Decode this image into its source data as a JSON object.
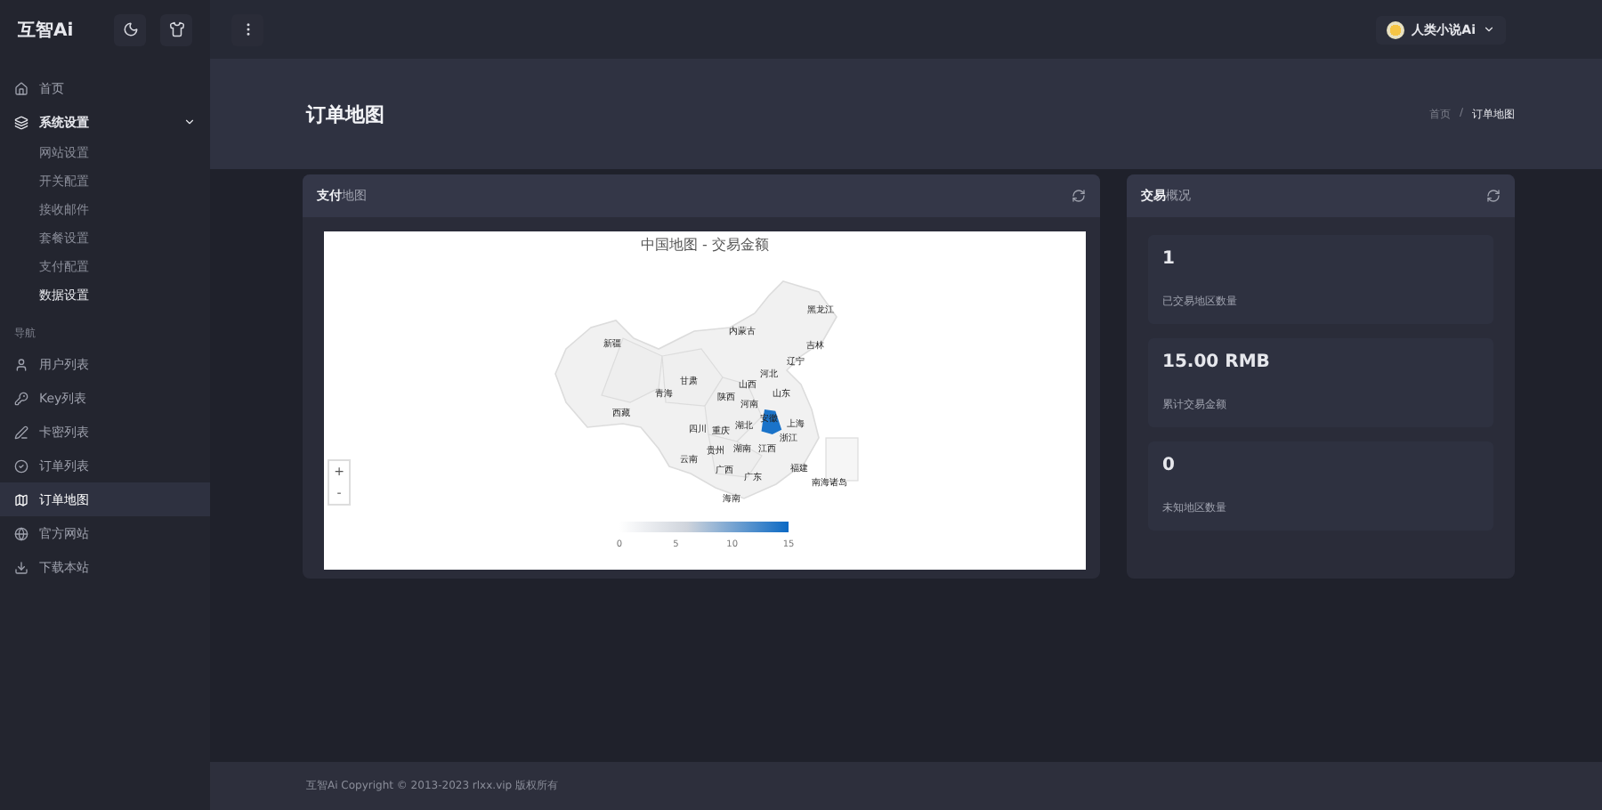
{
  "sidebar": {
    "logo": "互智Ai",
    "items": [
      {
        "kind": "link",
        "label": "首页",
        "selected": false
      },
      {
        "kind": "group",
        "label": "系统设置",
        "expanded": true,
        "selected": false,
        "children": [
          {
            "label": "网站设置",
            "selected": false
          },
          {
            "label": "开关配置",
            "selected": false
          },
          {
            "label": "接收邮件",
            "selected": false
          },
          {
            "label": "套餐设置",
            "selected": false
          },
          {
            "label": "支付配置",
            "selected": false
          },
          {
            "label": "数据设置",
            "selected": true
          }
        ]
      },
      {
        "kind": "section",
        "label": "导航"
      },
      {
        "kind": "link",
        "label": "用户列表",
        "selected": false
      },
      {
        "kind": "link",
        "label": "Key列表",
        "selected": false
      },
      {
        "kind": "link",
        "label": "卡密列表",
        "selected": false
      },
      {
        "kind": "link",
        "label": "订单列表",
        "selected": false
      },
      {
        "kind": "link",
        "label": "订单地图",
        "selected": true
      },
      {
        "kind": "link",
        "label": "官方网站",
        "selected": false
      },
      {
        "kind": "link",
        "label": "下载本站",
        "selected": false
      }
    ]
  },
  "topbar": {
    "user": "人类小说Ai"
  },
  "page_header": {
    "title": "订单地图",
    "breadcrumb": [
      "首页",
      "/",
      "订单地图"
    ]
  },
  "map_card": {
    "title": "**支付**地图",
    "map": {
      "title": "中国地图 - 交易金额",
      "zoom_buttons": [
        "+",
        "-"
      ],
      "legend": [
        "0",
        "5",
        "10",
        "15"
      ],
      "regions": [
        {
          "name": "黑龙江",
          "highlighted": false
        },
        {
          "name": "内蒙古",
          "highlighted": false
        },
        {
          "name": "新疆",
          "highlighted": false
        },
        {
          "name": "吉林",
          "highlighted": false
        },
        {
          "name": "辽宁",
          "highlighted": false
        },
        {
          "name": "河北",
          "highlighted": false
        },
        {
          "name": "甘肃",
          "highlighted": false
        },
        {
          "name": "山西",
          "highlighted": false
        },
        {
          "name": "青海",
          "highlighted": false
        },
        {
          "name": "陕西",
          "highlighted": false
        },
        {
          "name": "山东",
          "highlighted": false
        },
        {
          "name": "河南",
          "highlighted": false
        },
        {
          "name": "西藏",
          "highlighted": false
        },
        {
          "name": "安徽",
          "highlighted": true
        },
        {
          "name": "四川",
          "highlighted": false
        },
        {
          "name": "重庆",
          "highlighted": false
        },
        {
          "name": "湖北",
          "highlighted": false
        },
        {
          "name": "上海",
          "highlighted": false
        },
        {
          "name": "浙江",
          "highlighted": false
        },
        {
          "name": "贵州",
          "highlighted": false
        },
        {
          "name": "湖南",
          "highlighted": false
        },
        {
          "name": "江西",
          "highlighted": false
        },
        {
          "name": "云南",
          "highlighted": false
        },
        {
          "name": "广西",
          "highlighted": false
        },
        {
          "name": "福建",
          "highlighted": false
        },
        {
          "name": "广东",
          "highlighted": false
        },
        {
          "name": "南海诸岛",
          "highlighted": false
        },
        {
          "name": "海南",
          "highlighted": false
        }
      ]
    }
  },
  "stats_card": {
    "title": "**交易**概况",
    "stats": [
      {
        "value": "1",
        "label": "已交易地区数量"
      },
      {
        "value": "15.00 RMB",
        "label": "累计交易金额"
      },
      {
        "value": "0",
        "label": "未知地区数量"
      }
    ]
  },
  "footer": "互智Ai Copyright © 2013-2023 rlxx.vip 版权所有"
}
